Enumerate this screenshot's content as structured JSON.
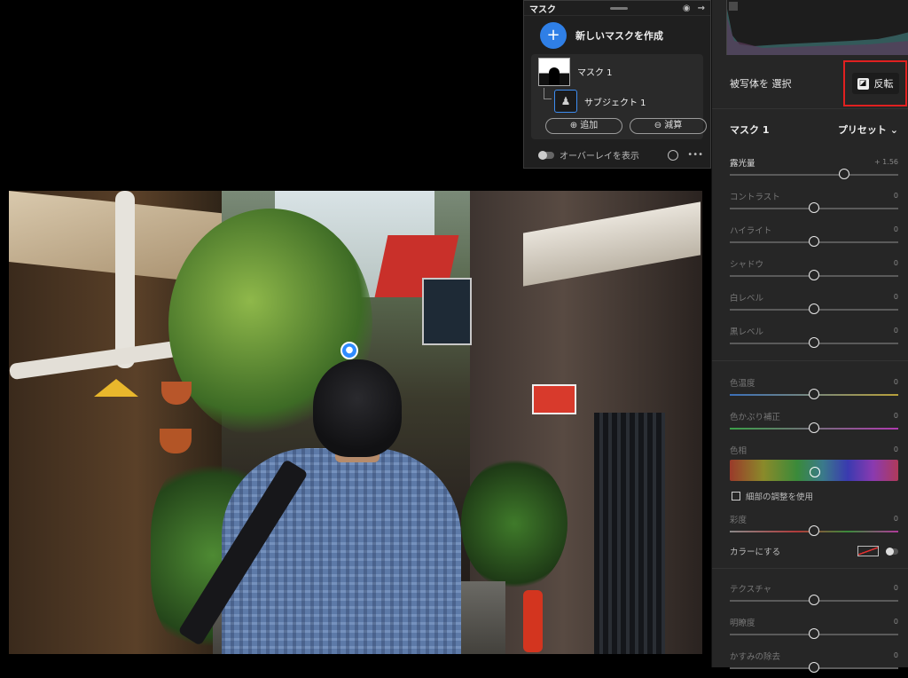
{
  "mask_panel": {
    "title": "マスク",
    "new_mask_label": "新しいマスクを作成",
    "mask_name": "マスク 1",
    "subject_name": "サブジェクト 1",
    "add_label": "追加",
    "subtract_label": "減算",
    "overlay_label": "オーバーレイを表示",
    "more_label": "•••"
  },
  "right_panel": {
    "select_subject": "被写体を 選択",
    "invert_label": "反転",
    "mask_title": "マスク 1",
    "preset_label": "プリセット",
    "sliders": [
      {
        "label": "露光量",
        "value": "+ 1.56",
        "position": 0.68
      },
      {
        "label": "コントラスト",
        "value": "0",
        "position": 0.5
      },
      {
        "label": "ハイライト",
        "value": "0",
        "position": 0.5
      },
      {
        "label": "シャドウ",
        "value": "0",
        "position": 0.5
      },
      {
        "label": "白レベル",
        "value": "0",
        "position": 0.5
      },
      {
        "label": "黒レベル",
        "value": "0",
        "position": 0.5
      }
    ],
    "color_sliders": [
      {
        "label": "色温度",
        "value": "0",
        "position": 0.5
      },
      {
        "label": "色かぶり補正",
        "value": "0",
        "position": 0.5
      }
    ],
    "hue_label": "色相",
    "hue_value": "0",
    "fine_adjust_label": "細部の調整を使用",
    "saturation_label": "彩度",
    "saturation_value": "0",
    "colorize_label": "カラーにする",
    "texture_sliders": [
      {
        "label": "テクスチャ",
        "value": "0",
        "position": 0.5
      },
      {
        "label": "明瞭度",
        "value": "0",
        "position": 0.5
      },
      {
        "label": "かすみの除去",
        "value": "0",
        "position": 0.5
      }
    ]
  },
  "colors": {
    "accent": "#2f7fe6",
    "highlight_box": "#e02020",
    "panel_bg": "#262626"
  },
  "icons": {
    "visibility": "eye-icon",
    "collapse": "arrow-right-icon",
    "add": "plus-icon",
    "invert": "invert-icon",
    "preset_dropdown": "chevron-down-icon",
    "subject_marker": "person-icon"
  }
}
